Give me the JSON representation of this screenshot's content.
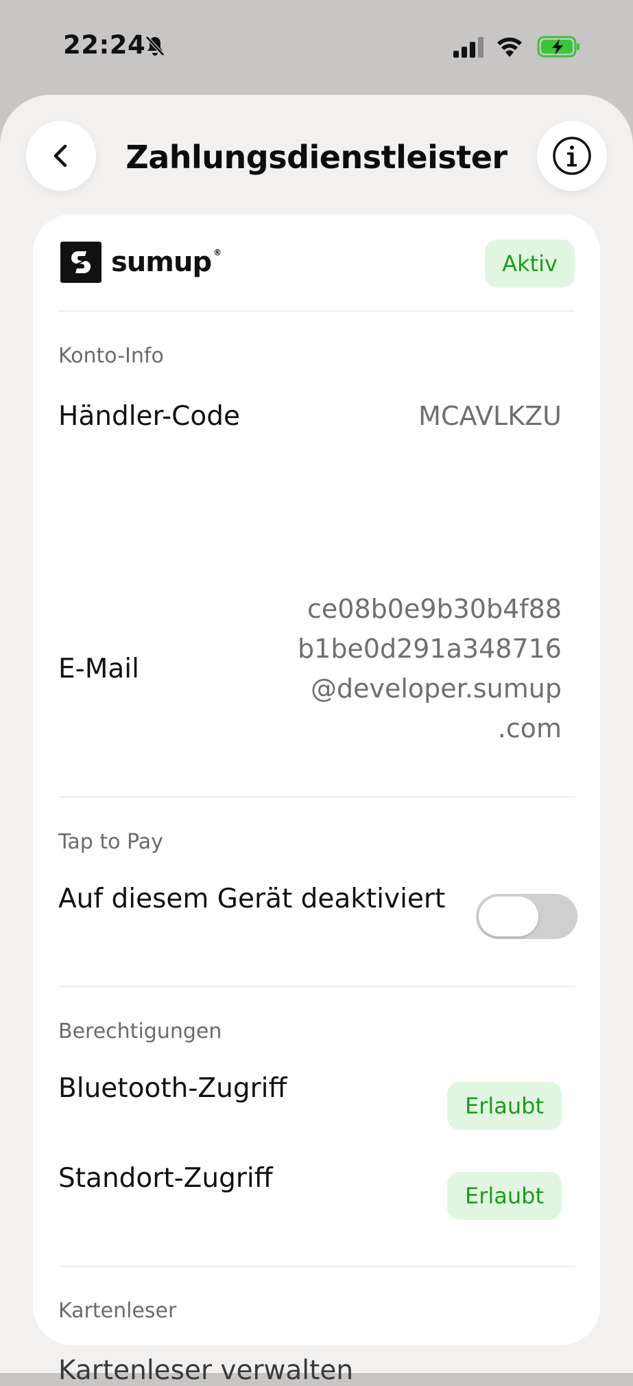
{
  "status_bar": {
    "time": "22:24",
    "icons": [
      "bell-slash-icon",
      "cellular-signal-icon",
      "wifi-icon",
      "battery-charging-icon"
    ],
    "battery_color": "#3cc43c"
  },
  "header": {
    "title": "Zahlungsdienstleister",
    "back_icon": "chevron-left-icon",
    "info_icon": "info-icon"
  },
  "provider": {
    "logo_text": "sumup",
    "logo_reg": "®",
    "status": "Aktiv",
    "status_color": "#1d9a1d",
    "status_bg": "#e1f6e1"
  },
  "account_info": {
    "section_label": "Konto-Info",
    "merchant_code_label": "Händler-Code",
    "merchant_code_value": "MCAVLKZU",
    "email_label": "E-Mail",
    "email_value": "ce08b0e9b30b4f88\nb1be0d291a348716\n@developer.sumup\n.com"
  },
  "tap_to_pay": {
    "section_label": "Tap to Pay",
    "toggle_label": "Auf diesem Gerät deaktiviert",
    "toggle_on": false
  },
  "permissions": {
    "section_label": "Berechtigungen",
    "items": [
      {
        "label": "Bluetooth-Zugriff",
        "status": "Erlaubt"
      },
      {
        "label": "Standort-Zugriff",
        "status": "Erlaubt"
      }
    ]
  },
  "card_reader": {
    "section_label": "Kartenleser",
    "manage_label": "Kartenleser verwalten"
  }
}
